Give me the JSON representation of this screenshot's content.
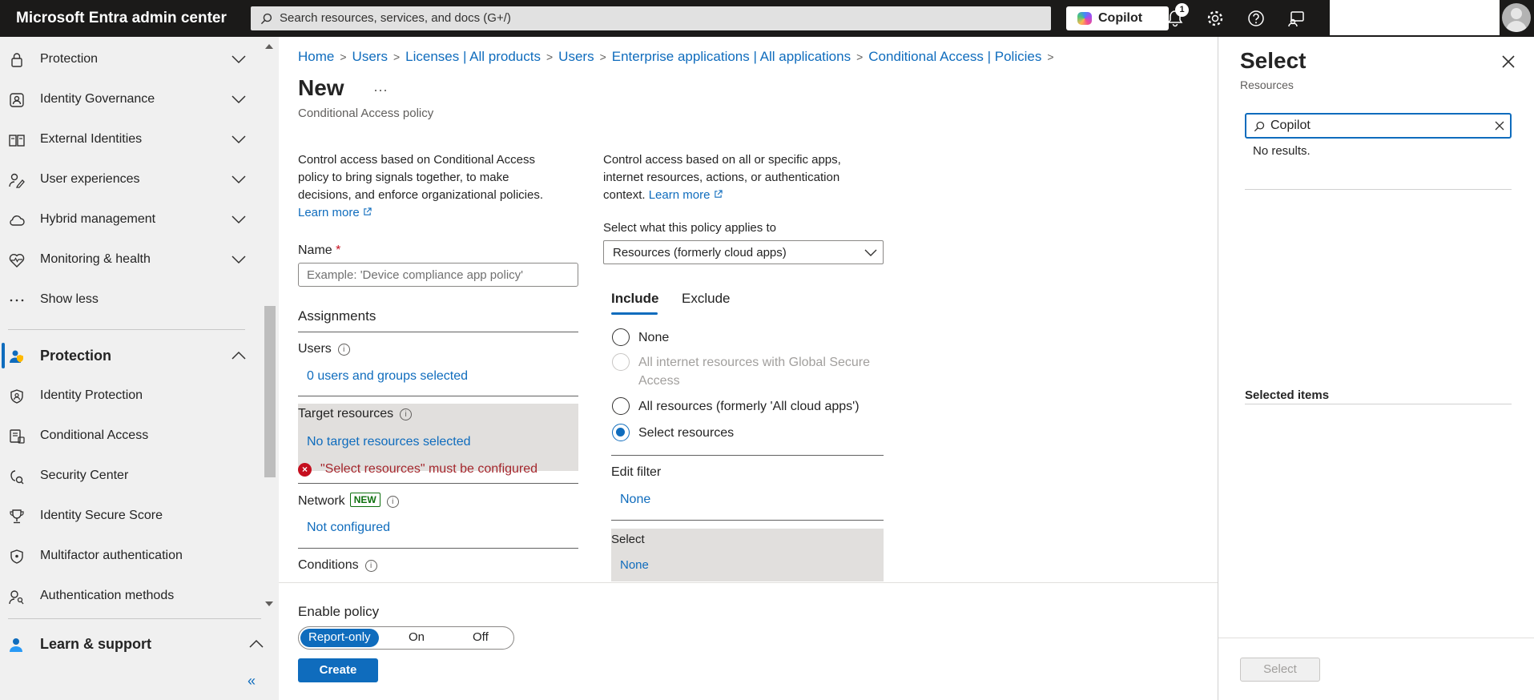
{
  "app": {
    "title": "Microsoft Entra admin center"
  },
  "search": {
    "placeholder": "Search resources, services, and docs (G+/)"
  },
  "topbar": {
    "copilot_label": "Copilot",
    "notification_count": "1"
  },
  "sidebar": {
    "items": [
      {
        "label": "Protection",
        "icon": "lock-icon"
      },
      {
        "label": "Identity Governance",
        "icon": "identity-governance-icon"
      },
      {
        "label": "External Identities",
        "icon": "external-identities-icon"
      },
      {
        "label": "User experiences",
        "icon": "user-experiences-icon"
      },
      {
        "label": "Hybrid management",
        "icon": "cloud-icon"
      },
      {
        "label": "Monitoring & health",
        "icon": "heart-pulse-icon"
      },
      {
        "label": "Show less",
        "icon": "ellipsis-icon"
      }
    ],
    "section": {
      "label": "Protection",
      "icon": "protection-person-icon"
    },
    "section_items": [
      {
        "label": "Identity Protection",
        "icon": "shield-icon"
      },
      {
        "label": "Conditional Access",
        "icon": "conditional-access-icon"
      },
      {
        "label": "Security Center",
        "icon": "security-center-icon"
      },
      {
        "label": "Identity Secure Score",
        "icon": "trophy-icon"
      },
      {
        "label": "Multifactor authentication",
        "icon": "shield-check-icon"
      },
      {
        "label": "Authentication methods",
        "icon": "key-person-icon"
      }
    ],
    "learn": {
      "label": "Learn & support",
      "icon": "learn-support-icon"
    },
    "collapse_glyph": "«"
  },
  "breadcrumb": [
    "Home",
    "Users",
    "Licenses | All products",
    "Users",
    "Enterprise applications | All applications",
    "Conditional Access | Policies"
  ],
  "page": {
    "title": "New",
    "more": "···",
    "subtitle": "Conditional Access policy"
  },
  "left": {
    "intro": "Control access based on Conditional Access policy to bring signals together, to make decisions, and enforce organizational policies.",
    "learn_more": "Learn more",
    "name_label": "Name",
    "name_required": "*",
    "name_placeholder": "Example: 'Device compliance app policy'",
    "assignments": "Assignments",
    "users_label": "Users",
    "users_value": "0 users and groups selected",
    "target_label": "Target resources",
    "target_value": "No target resources selected",
    "target_error": "\"Select resources\" must be configured",
    "network_label": "Network",
    "network_badge": "NEW",
    "network_value": "Not configured",
    "conditions_label": "Conditions"
  },
  "right": {
    "intro": "Control access based on all or specific apps, internet resources, actions, or authentication context.",
    "learn_more": "Learn more",
    "applies_label": "Select what this policy applies to",
    "applies_value": "Resources (formerly cloud apps)",
    "tabs": [
      "Include",
      "Exclude"
    ],
    "radios": [
      {
        "label": "None"
      },
      {
        "label": "All internet resources with Global Secure Access"
      },
      {
        "label": "All resources (formerly 'All cloud apps')"
      },
      {
        "label": "Select resources"
      }
    ],
    "edit_filter_label": "Edit filter",
    "edit_filter_value": "None",
    "select_label": "Select",
    "select_value": "None"
  },
  "footer": {
    "enable_label": "Enable policy",
    "toggle": [
      "Report-only",
      "On",
      "Off"
    ],
    "create": "Create"
  },
  "panel": {
    "title": "Select",
    "subtitle": "Resources",
    "search_value": "Copilot",
    "no_results": "No results.",
    "selected_items": "Selected items",
    "select_button": "Select"
  },
  "colors": {
    "accent": "#0f6cbd",
    "topbar": "#1b1a19",
    "error": "#c50f1f"
  }
}
